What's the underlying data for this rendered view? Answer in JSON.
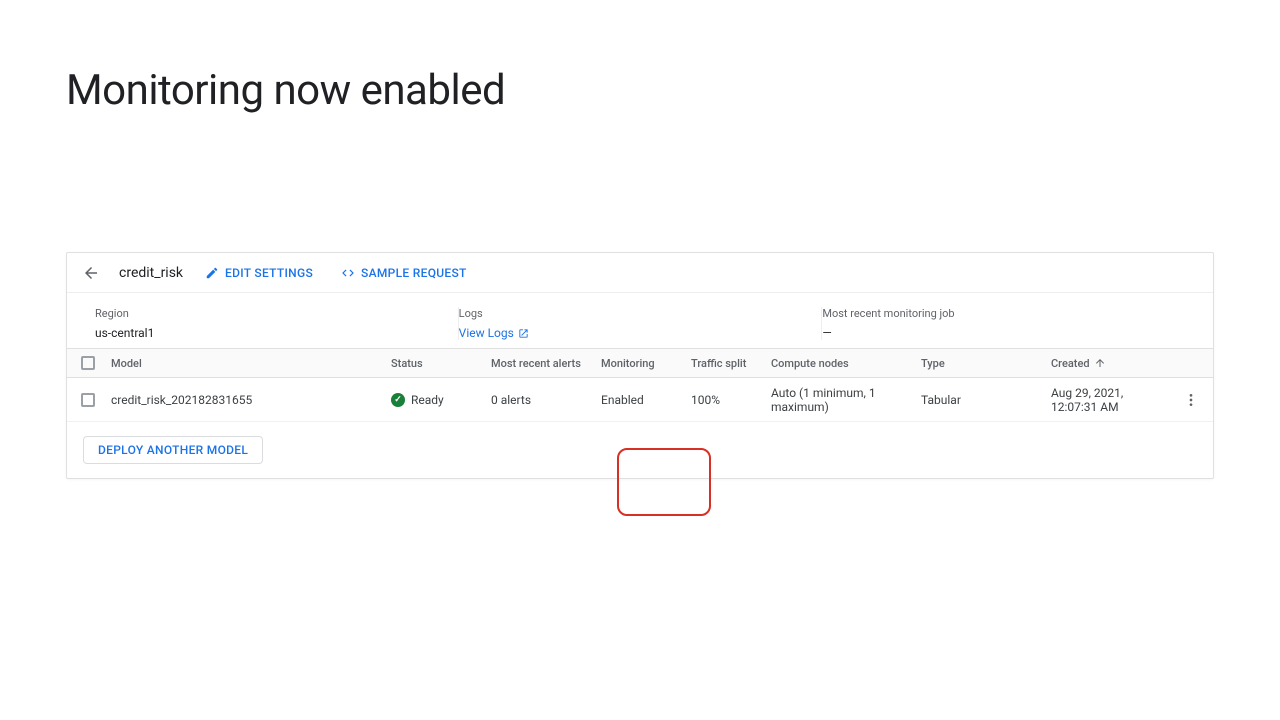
{
  "page": {
    "title": "Monitoring now enabled"
  },
  "toolbar": {
    "title": "credit_risk",
    "edit_label": "EDIT SETTINGS",
    "sample_label": "SAMPLE REQUEST"
  },
  "info": {
    "region_label": "Region",
    "region_value": "us-central1",
    "logs_label": "Logs",
    "logs_link": "View Logs",
    "monjob_label": "Most recent monitoring job",
    "monjob_value": "—"
  },
  "columns": {
    "model": "Model",
    "status": "Status",
    "alerts": "Most recent alerts",
    "monitoring": "Monitoring",
    "traffic": "Traffic split",
    "compute": "Compute nodes",
    "type": "Type",
    "created": "Created"
  },
  "row": {
    "model": "credit_risk_202182831655",
    "status": "Ready",
    "alerts": "0 alerts",
    "monitoring": "Enabled",
    "traffic": "100%",
    "compute": "Auto (1 minimum, 1 maximum)",
    "type": "Tabular",
    "created": "Aug 29, 2021, 12:07:31 AM"
  },
  "deploy_label": "DEPLOY ANOTHER MODEL"
}
